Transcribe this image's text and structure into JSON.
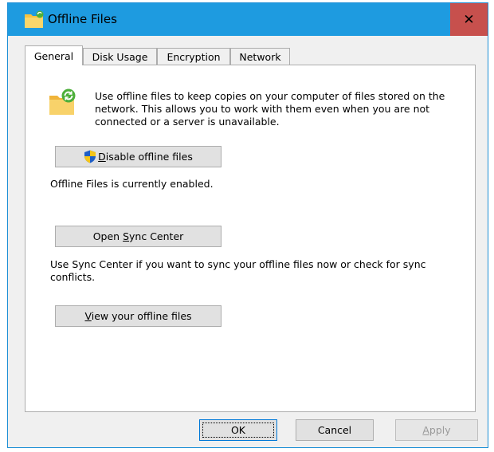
{
  "window": {
    "title": "Offline Files",
    "close_glyph": "✕",
    "icons": {
      "title": "offline-files-folder-icon",
      "close": "close-icon"
    }
  },
  "tabs": [
    {
      "label": "General",
      "selected": true
    },
    {
      "label": "Disk Usage",
      "selected": false
    },
    {
      "label": "Encryption",
      "selected": false
    },
    {
      "label": "Network",
      "selected": false
    }
  ],
  "general": {
    "intro_icon": "offline-files-sync-folder-icon",
    "intro": "Use offline files to keep copies on your computer of files stored on the network.  This allows you to work with them even when you are not connected or a server is unavailable.",
    "disable_button": {
      "mnemonic": "D",
      "rest": "isable offline files",
      "icon": "uac-shield-icon"
    },
    "status": "Offline Files is currently enabled.",
    "sync_button": {
      "before": "Open ",
      "mnemonic": "S",
      "after": "ync Center"
    },
    "sync_text": "Use Sync Center if you want to sync your offline files now or check for sync conflicts.",
    "view_button": {
      "mnemonic": "V",
      "rest": "iew your offline files"
    }
  },
  "footer": {
    "ok": "OK",
    "cancel": "Cancel",
    "apply": {
      "mnemonic": "A",
      "rest": "pply"
    }
  },
  "colors": {
    "titlebar": "#1e9be0",
    "close_button": "#c7504d",
    "dialog_face": "#f0f0f0",
    "button_face": "#e1e1e1",
    "default_button_border": "#0078d7"
  }
}
